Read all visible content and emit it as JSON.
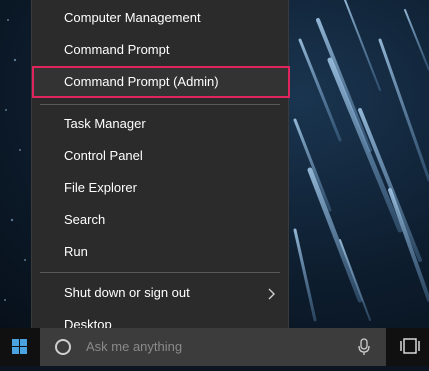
{
  "menu": {
    "items": [
      {
        "label": "Computer Management"
      },
      {
        "label": "Command Prompt"
      },
      {
        "label": "Command Prompt (Admin)"
      },
      {
        "label": "Task Manager"
      },
      {
        "label": "Control Panel"
      },
      {
        "label": "File Explorer"
      },
      {
        "label": "Search"
      },
      {
        "label": "Run"
      },
      {
        "label": "Shut down or sign out"
      },
      {
        "label": "Desktop"
      }
    ],
    "highlight_color": "#e0245e"
  },
  "taskbar": {
    "search_placeholder": "Ask me anything"
  },
  "icons": {
    "start": "windows-logo",
    "cortana": "circle",
    "mic": "microphone",
    "taskview": "task-view"
  }
}
